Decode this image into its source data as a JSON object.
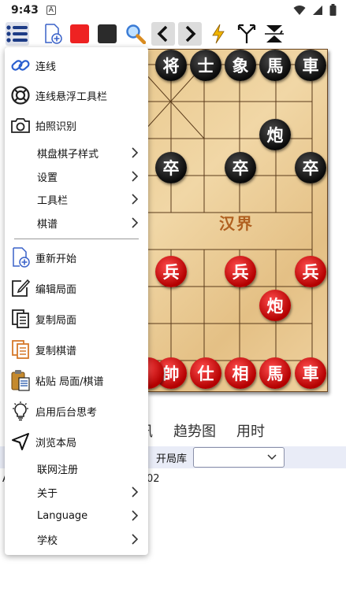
{
  "status_bar": {
    "time": "9:43",
    "badge": "A"
  },
  "toolbar": {
    "icons": [
      "menu-icon",
      "new-game-icon",
      "red-square-icon",
      "black-square-icon",
      "search-icon",
      "back-icon",
      "forward-icon",
      "bolt-icon",
      "branch-icon",
      "flip-icon"
    ],
    "colors": {
      "red": "#ee2222",
      "black": "#2b2b2b",
      "menu_blue": "#1c3b86",
      "bolt": "#f0b400"
    }
  },
  "board": {
    "river_text": "汉界",
    "pieces": [
      {
        "char": "将",
        "side": "black"
      },
      {
        "char": "士",
        "side": "black"
      },
      {
        "char": "象",
        "side": "black"
      },
      {
        "char": "馬",
        "side": "black"
      },
      {
        "char": "車",
        "side": "black"
      },
      {
        "char": "炮",
        "side": "black"
      },
      {
        "char": "卒",
        "side": "black"
      },
      {
        "char": "卒",
        "side": "black"
      },
      {
        "char": "卒",
        "side": "black"
      },
      {
        "char": "兵",
        "side": "red"
      },
      {
        "char": "兵",
        "side": "red"
      },
      {
        "char": "兵",
        "side": "red"
      },
      {
        "char": "炮",
        "side": "red"
      },
      {
        "char": "帥",
        "side": "red"
      },
      {
        "char": "仕",
        "side": "red"
      },
      {
        "char": "相",
        "side": "red"
      },
      {
        "char": "馬",
        "side": "red"
      },
      {
        "char": "車",
        "side": "red"
      }
    ]
  },
  "tabs": {
    "partial": "讯",
    "trend": "趋势图",
    "time": "用时"
  },
  "options": {
    "opening_label": "开局库",
    "opening_value": ""
  },
  "background_text": {
    "number": "02",
    "prefix": "A"
  },
  "menu": {
    "items": [
      {
        "label": "连线",
        "icon": "link-icon"
      },
      {
        "label": "连线悬浮工具栏",
        "icon": "lifebuoy-icon"
      },
      {
        "label": "拍照识别",
        "icon": "camera-icon"
      },
      {
        "label": "棋盘棋子样式",
        "submenu": true
      },
      {
        "label": "设置",
        "submenu": true
      },
      {
        "label": "工具栏",
        "submenu": true
      },
      {
        "label": "棋谱",
        "submenu": true
      },
      {
        "label": "重新开始",
        "icon": "new-document-icon"
      },
      {
        "label": "编辑局面",
        "icon": "edit-icon"
      },
      {
        "label": "复制局面",
        "icon": "copy-position-icon"
      },
      {
        "label": "复制棋谱",
        "icon": "copy-record-icon"
      },
      {
        "label": "粘贴 局面/棋谱",
        "icon": "paste-icon"
      },
      {
        "label": "启用后台思考",
        "icon": "lightbulb-icon"
      },
      {
        "label": "浏览本局",
        "icon": "navigate-icon"
      },
      {
        "label": "联网注册"
      },
      {
        "label": "关于",
        "submenu": true
      },
      {
        "label": "Language",
        "submenu": true
      },
      {
        "label": "学校",
        "submenu": true
      }
    ]
  }
}
